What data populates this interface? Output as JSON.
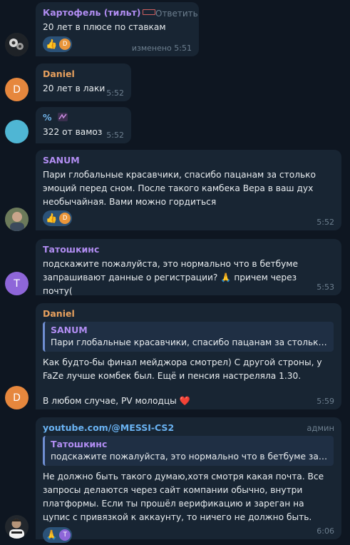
{
  "colors": {
    "background": "#0e1621",
    "bubble": "#182533",
    "reaction": "#2b5278",
    "author_purple": "#b18df2",
    "author_orange": "#e9a15e",
    "author_blue": "#6fb2e8",
    "link": "#6ab3f3"
  },
  "messages": [
    {
      "author": "Картофель (тильт)",
      "author_badge": "flag-icon",
      "reply_label": "Ответить",
      "text": "20 лет в плюсе по ставкам",
      "time": "изменено 5:51",
      "reactions": [
        {
          "emoji": "👍",
          "user_initial": "D"
        }
      ]
    },
    {
      "author": "Daniel",
      "avatar_initial": "D",
      "text": "20 лет в лаки",
      "time": "5:52"
    },
    {
      "author": "%",
      "author_badge": "sticker-icon",
      "text": "322 от вамоз",
      "time": "5:52"
    },
    {
      "author": "SANUM",
      "text": "Пари глобальные красавчики, спасибо пацанам за столько эмоций перед сном. После такого камбека Вера в ваш дух необычайная. Вами можно гордиться",
      "time": "5:52",
      "reactions": [
        {
          "emoji": "👍",
          "user_initial": "D"
        }
      ]
    },
    {
      "author": "Татошкинс",
      "avatar_initial": "T",
      "text": "подскажите пожалуйста, это нормально что в бетбуме запрашивают данные о регистрации? 🙏 причем через почту(",
      "time": "5:53"
    },
    {
      "author": "Daniel",
      "avatar_initial": "D",
      "quote_author": "SANUM",
      "quote_text": "Пари глобальные красавчики, спасибо пацанам за столько э...",
      "text": "Как будто-бы финал мейджора смотрел) С другой строны, у FaZe лучше комбек был. Ещё и пенсия настреляла 1.30.",
      "text2": "В любом случае, PV молодцы ❤️",
      "time": "5:59"
    },
    {
      "author": "youtube.com/@MESSI-CS2",
      "role": "админ",
      "quote_author": "Татошкинс",
      "quote_text": "подскажите пожалуйста, это нормально что в бетбуме запра...",
      "text": "Не должно быть такого думаю,хотя смотря какая почта. Все запросы делаются через сайт компании обычно, внутри платформы. Если ты прошёл верификацию и зареган на цупис с привязкой к аккаунту, то ничего не должно быть.",
      "time": "6:06",
      "reactions": [
        {
          "emoji": "🙏",
          "user_initial": "T"
        }
      ]
    }
  ]
}
